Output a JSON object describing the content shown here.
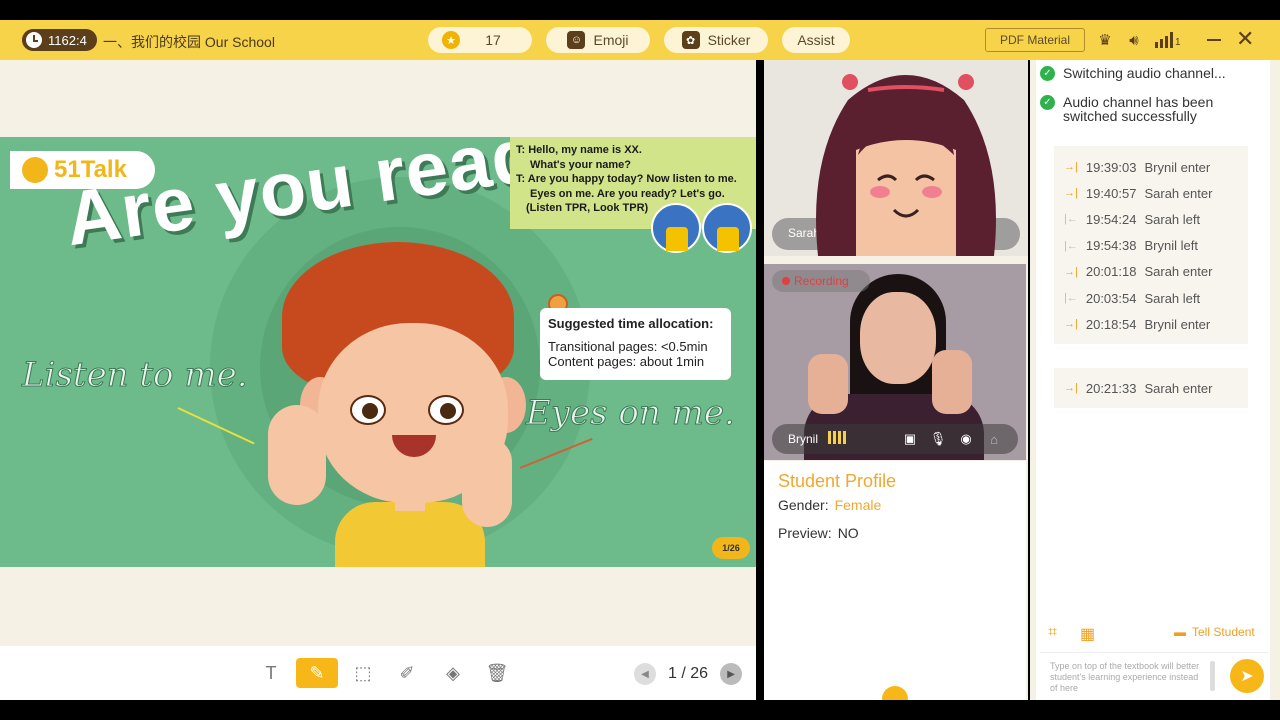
{
  "topbar": {
    "timer": "1162:4",
    "lesson_title": "一、我们的校园 Our School",
    "star_count": "17",
    "emoji_label": "Emoji",
    "sticker_label": "Sticker",
    "assist_label": "Assist",
    "pdf_label": "PDF Material",
    "signal_num": "1",
    "icons": [
      "clock-icon",
      "star-icon",
      "emoji-icon",
      "sticker-icon",
      "cup-icon",
      "speaker-icon",
      "signal-icon",
      "minimize-icon",
      "close-icon"
    ]
  },
  "slide": {
    "logo": "51Talk",
    "title": "Are you ready?",
    "tips": [
      "T: Hello, my name is XX.",
      "What's your name?",
      "T: Are you happy today? Now listen to me.",
      "Eyes on me. Are you ready? Let's go.",
      "(Listen TPR, Look TPR)"
    ],
    "alloc_title": "Suggested time allocation:",
    "alloc_lines": [
      "Transitional pages: <0.5min",
      "Content pages: about 1min"
    ],
    "script_left": "Listen to me.",
    "script_right": "Eyes on me.",
    "page_badge": "1/26"
  },
  "toolbar": {
    "tools": [
      "text-tool",
      "brush-tool",
      "select-tool",
      "pen-tool",
      "eraser-tool",
      "delete-tool"
    ],
    "active_tool": "brush-tool",
    "page_current": "1",
    "page_sep": "/",
    "page_total": "26"
  },
  "video": {
    "teacher_name": "Sarah",
    "student_name": "Brynil",
    "recording_label": "Recording"
  },
  "profile": {
    "title": "Student Profile",
    "gender_label": "Gender:",
    "gender_value": "Female",
    "preview_label": "Preview:",
    "preview_value": "NO"
  },
  "chat": {
    "notices": [
      "Switching audio channel...",
      "Audio channel has been switched successfully"
    ],
    "log": [
      {
        "time": "19:39:03",
        "text": "Brynil enter",
        "dir": "in"
      },
      {
        "time": "19:40:57",
        "text": "Sarah enter",
        "dir": "in"
      },
      {
        "time": "19:54:24",
        "text": "Sarah left",
        "dir": "out"
      },
      {
        "time": "19:54:38",
        "text": "Brynil left",
        "dir": "out"
      },
      {
        "time": "20:01:18",
        "text": "Sarah enter",
        "dir": "in"
      },
      {
        "time": "20:03:54",
        "text": "Sarah left",
        "dir": "out"
      },
      {
        "time": "20:18:54",
        "text": "Brynil enter",
        "dir": "in"
      }
    ],
    "log2": [
      {
        "time": "20:21:33",
        "text": "Sarah enter",
        "dir": "in"
      }
    ],
    "tell_student": "Tell Student",
    "input_placeholder": "Type on top of the textbook will better student's learning experience instead of here"
  }
}
